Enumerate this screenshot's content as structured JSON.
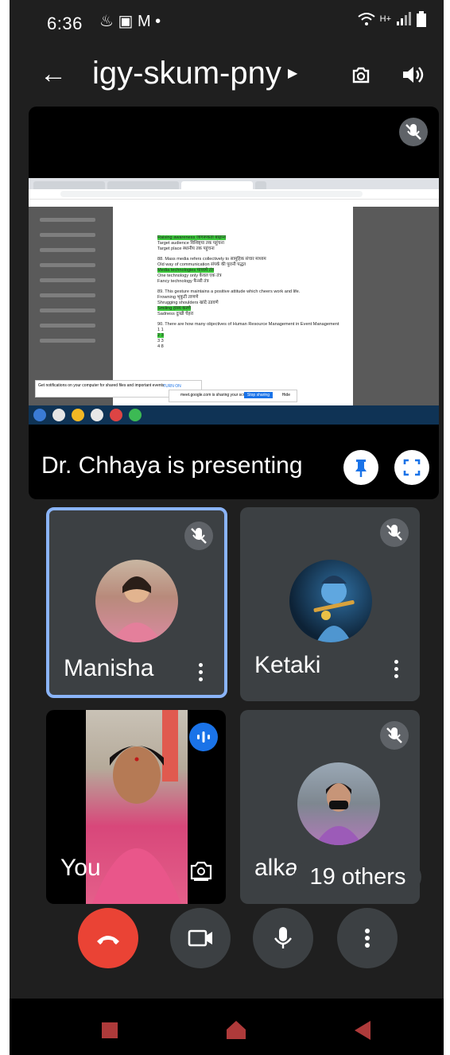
{
  "status_bar": {
    "time": "6:36",
    "notification_icons": "♨ ▣ M •",
    "network": "H+"
  },
  "header": {
    "meeting_code": "igy-skum-pny"
  },
  "presentation": {
    "label": "Dr. Chhaya is presenting",
    "shared_doc_lines": [
      "Raising awareness जागरूकता बाढ़ाना",
      "Target audience विशिष्ट्या तक पहुंचना",
      "Target place स्थानीय तक पहुंचना",
      "88. Mass media refers collectively to सामूहिक संचार माध्यम",
      "Old way of communication संपर्क की पुरानी पद्धत",
      "Media technologies माध्यमे तंत्र",
      "One technology only केवल एक तंत्र",
      "Fancy technology फैन्सी तंत्र",
      "89. This gesture maintains a positive attitude which cheers work and life.",
      "Frowning भृकुटी ताणणे",
      "Shrugging shoulders खांदे उडवणे",
      "Smiling हास्य करणे",
      "Sadness दुःखी चेहरा",
      "90. There are how many objectives of Human Resource Management in Event Management",
      "1 1",
      "2 3",
      "3 3",
      "4 8"
    ],
    "notification_text": "Get notifications on your computer for shared files and important events",
    "turn_on": "TURN ON",
    "sharing_text": "meet.google.com is sharing your screen.",
    "stop_sharing": "Stop sharing",
    "hide": "Hide"
  },
  "participants": [
    {
      "name": "Manisha",
      "muted": true,
      "active": true
    },
    {
      "name": "Ketaki",
      "muted": true,
      "active": false
    },
    {
      "name": "You",
      "muted": false,
      "active": false
    },
    {
      "name": "alka",
      "muted": true,
      "active": false
    }
  ],
  "others_label": "19 others",
  "colors": {
    "end_call": "#ea4335",
    "active_tile_border": "#8ab4f8",
    "speaking_indicator": "#1a73e8",
    "tile_bg": "#3c4043"
  }
}
